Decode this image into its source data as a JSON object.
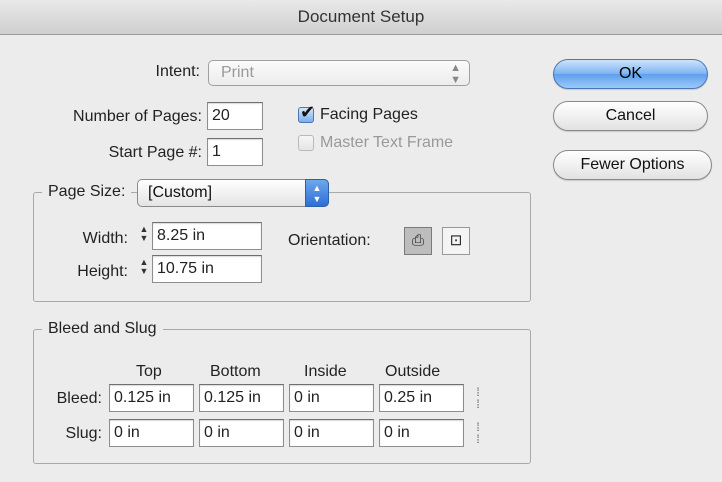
{
  "window": {
    "title": "Document Setup"
  },
  "intent": {
    "label": "Intent:",
    "value": "Print"
  },
  "pages": {
    "number_label": "Number of Pages:",
    "number_value": "20",
    "start_label": "Start Page #:",
    "start_value": "1",
    "facing_label": "Facing Pages",
    "facing_checked": true,
    "master_label": "Master Text Frame",
    "master_checked": false
  },
  "buttons": {
    "ok": "OK",
    "cancel": "Cancel",
    "fewer": "Fewer Options"
  },
  "page_size": {
    "label": "Page Size:",
    "value": "[Custom]",
    "width_label": "Width:",
    "width_value": "8.25 in",
    "height_label": "Height:",
    "height_value": "10.75 in",
    "orientation_label": "Orientation:",
    "orientation_selected": "portrait"
  },
  "bleed_slug": {
    "title": "Bleed and Slug",
    "columns": [
      "Top",
      "Bottom",
      "Inside",
      "Outside"
    ],
    "bleed_label": "Bleed:",
    "bleed": [
      "0.125 in",
      "0.125 in",
      "0 in",
      "0.25 in"
    ],
    "slug_label": "Slug:",
    "slug": [
      "0 in",
      "0 in",
      "0 in",
      "0 in"
    ]
  }
}
